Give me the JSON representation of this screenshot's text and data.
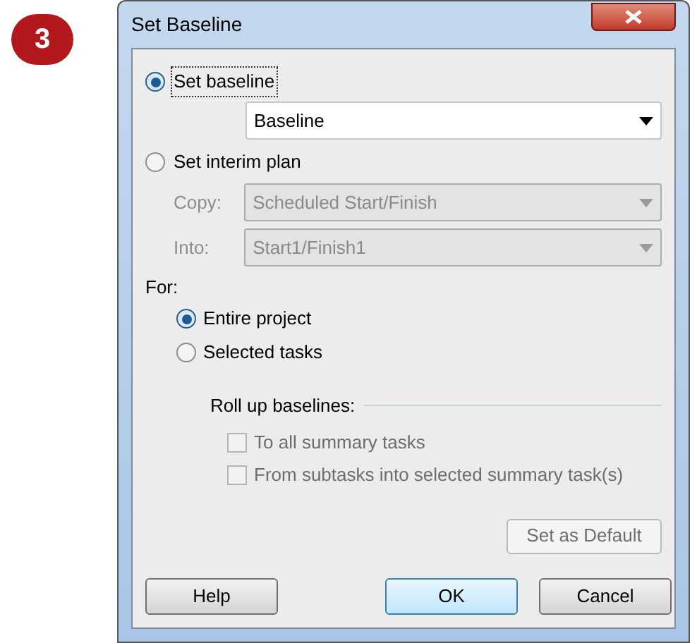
{
  "step_badge": "3",
  "window": {
    "title": "Set Baseline"
  },
  "baseline_options": [
    {
      "label": "Set baseline",
      "selected": true,
      "focused": true
    },
    {
      "label": "Set interim plan",
      "selected": false,
      "focused": false
    }
  ],
  "baseline_field": {
    "value": "Baseline",
    "disabled": false
  },
  "interim_fields": [
    {
      "label": "Copy:",
      "value": "Scheduled Start/Finish",
      "disabled": true
    },
    {
      "label": "Into:",
      "value": "Start1/Finish1",
      "disabled": true
    }
  ],
  "for_label": "For:",
  "for_options": [
    {
      "label": "Entire project",
      "selected": true
    },
    {
      "label": "Selected tasks",
      "selected": false
    }
  ],
  "roll_up": {
    "title": "Roll up baselines:",
    "options": [
      {
        "label": "To all summary tasks",
        "checked": false,
        "disabled": true
      },
      {
        "label": "From subtasks into selected summary task(s)",
        "checked": false,
        "disabled": true
      }
    ]
  },
  "set_default_button": {
    "label": "Set as Default",
    "disabled": true
  },
  "buttons": [
    {
      "label": "Help",
      "default": false
    },
    {
      "label": "OK",
      "default": true
    },
    {
      "label": "Cancel",
      "default": false
    }
  ]
}
